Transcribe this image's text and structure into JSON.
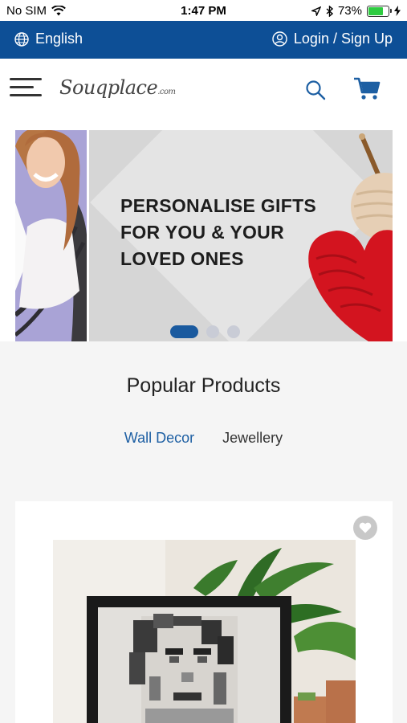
{
  "status_bar": {
    "carrier": "No SIM",
    "time": "1:47 PM",
    "battery": "73%"
  },
  "top_bar": {
    "language": "English",
    "login": "Login / Sign Up"
  },
  "header": {
    "logo_text": "Souqplace",
    "logo_suffix": ".com"
  },
  "banner": {
    "headline_lines": [
      "PERSONALISE GIFTS",
      "FOR YOU & YOUR",
      "LOVED ONES"
    ],
    "active_slide": 1,
    "slide_count": 3
  },
  "popular": {
    "title": "Popular Products",
    "tabs": [
      {
        "label": "Wall Decor",
        "active": true
      },
      {
        "label": "Jewellery",
        "active": false
      }
    ]
  },
  "colors": {
    "brand_blue": "#0d4f96",
    "accent_blue": "#1d5fa3",
    "background": "#f5f5f5"
  },
  "icons": [
    "wifi-icon",
    "globe-icon",
    "user-icon",
    "menu-icon",
    "search-icon",
    "cart-icon",
    "heart-icon",
    "location-icon",
    "bluetooth-icon",
    "battery-icon",
    "charging-icon"
  ]
}
